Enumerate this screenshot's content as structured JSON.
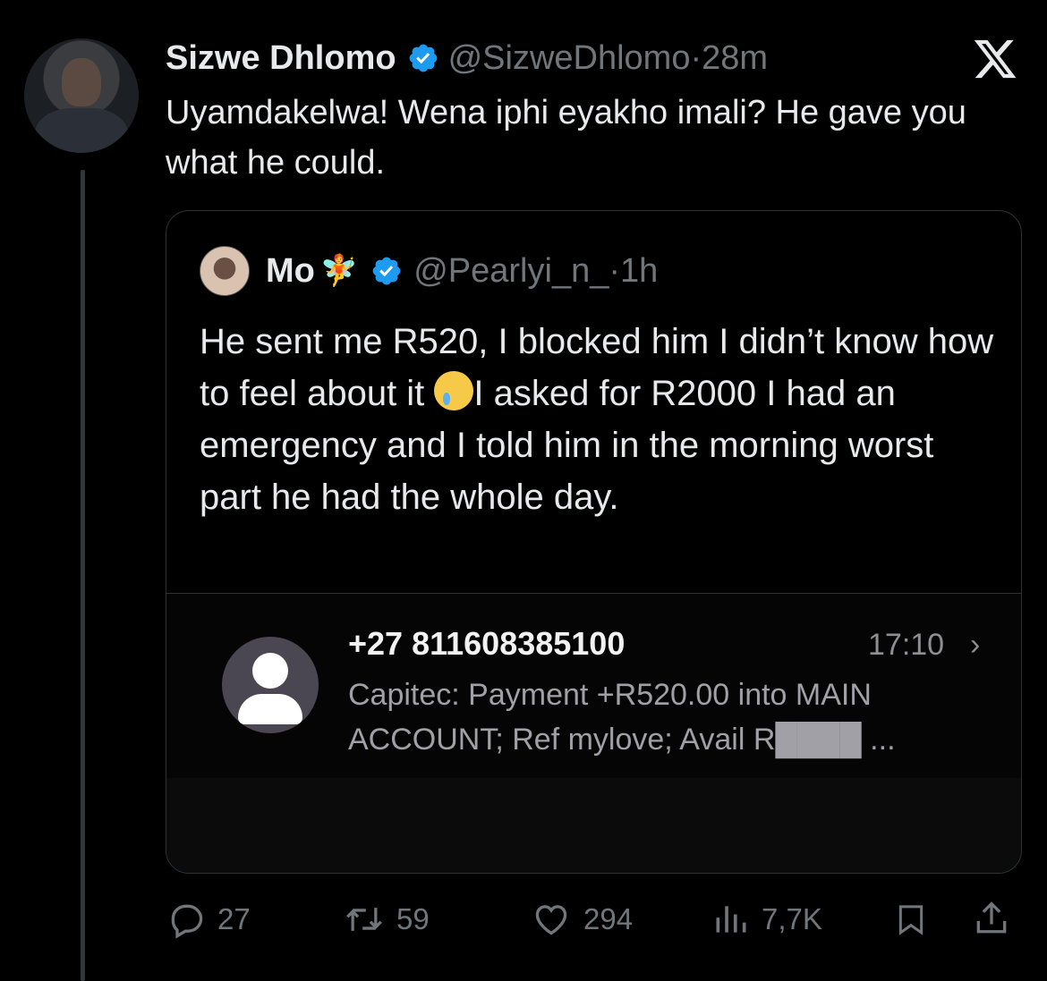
{
  "tweet": {
    "author_name": "Sizwe Dhlomo",
    "handle": "@SizweDhlomo",
    "separator": "·",
    "time": "28m",
    "text": "Uyamdakelwa! Wena iphi eyakho imali? He gave you what he could."
  },
  "quote": {
    "author_name": "Mo",
    "name_emoji": "🧚",
    "handle": "@Pearlyi_n_",
    "separator": "·",
    "time": "1h",
    "text_before_emoji": "He sent me R520, I blocked him I didn’t know how to feel about it ",
    "text_after_emoji": "I asked for R2000 I had an emergency and I told him in the morning worst part he had the whole day."
  },
  "sms_screenshot": {
    "number": "+27 811608385100",
    "time": "17:10",
    "chevron": "›",
    "body": "Capitec: Payment +R520.00 into MAIN ACCOUNT; Ref mylove; Avail R████ ..."
  },
  "actions": {
    "replies": "27",
    "reposts": "59",
    "likes": "294",
    "views": "7,7K"
  },
  "colors": {
    "background": "#000000",
    "text": "#e7e9ea",
    "secondary": "#71767b",
    "verified": "#1d9bf0",
    "border": "#2f3336"
  }
}
